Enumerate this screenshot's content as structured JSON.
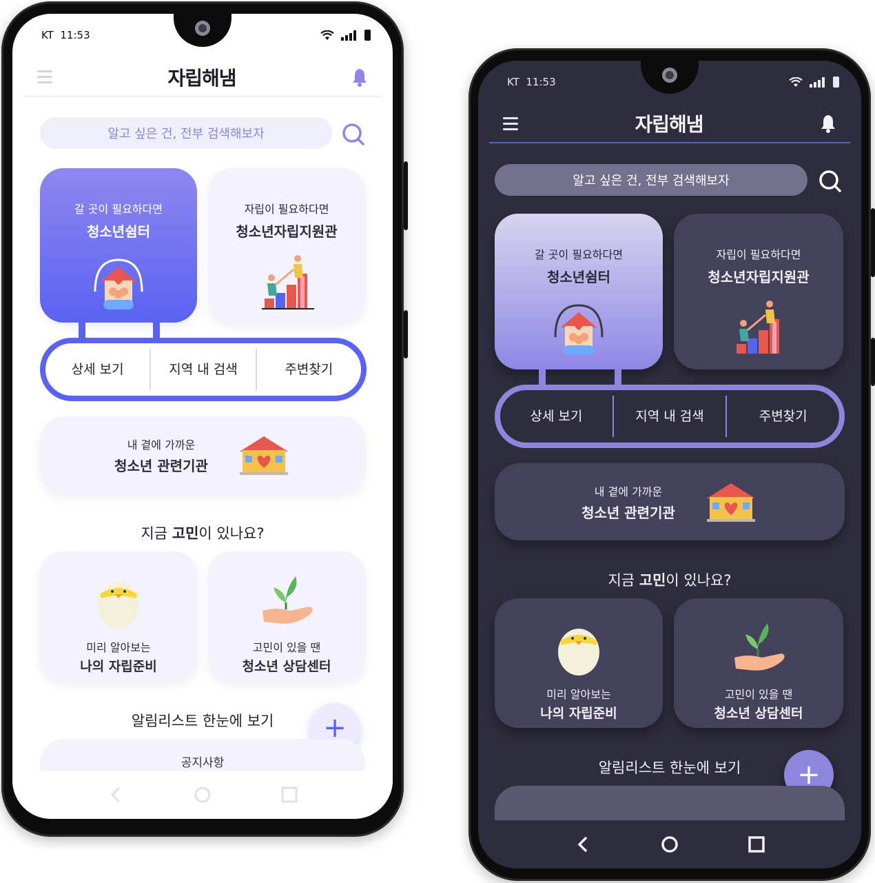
{
  "status": {
    "carrier": "KT",
    "time": "11:53"
  },
  "app": {
    "logo": "자립해냄"
  },
  "search": {
    "placeholder": "알고 싶은 건, 전부 검색해보자"
  },
  "cards": [
    {
      "sub": "갈 곳이 필요하다면",
      "main": "청소년쉼터",
      "icon": "shelter-house-icon"
    },
    {
      "sub": "자립이 필요하다면",
      "main": "청소년자립지원관",
      "icon": "climbing-bars-icon"
    }
  ],
  "actions": [
    "상세 보기",
    "지역 내 검색",
    "주변찾기"
  ],
  "nearby": {
    "sub": "내 곁에 가까운",
    "main": "청소년 관련기관",
    "icon": "heart-house-icon"
  },
  "question": {
    "pre": "지금 ",
    "bold": "고민",
    "post": "이 있나요?"
  },
  "bottom_cards": [
    {
      "sub": "미리 알아보는",
      "main": "나의 자립준비",
      "icon": "hatching-egg-icon"
    },
    {
      "sub": "고민이 있을 땐",
      "main": "청소년 상담센터",
      "icon": "hand-sprout-icon"
    }
  ],
  "alarm": {
    "title": "알림리스트 한눈에 보기",
    "fab": "+"
  },
  "notice": {
    "label": "공지사항"
  },
  "themes": {
    "light": {
      "accent": "#5a62f2",
      "background": "#ffffff"
    },
    "dark": {
      "accent": "#8d86dc",
      "background": "#2e2d3d"
    }
  }
}
